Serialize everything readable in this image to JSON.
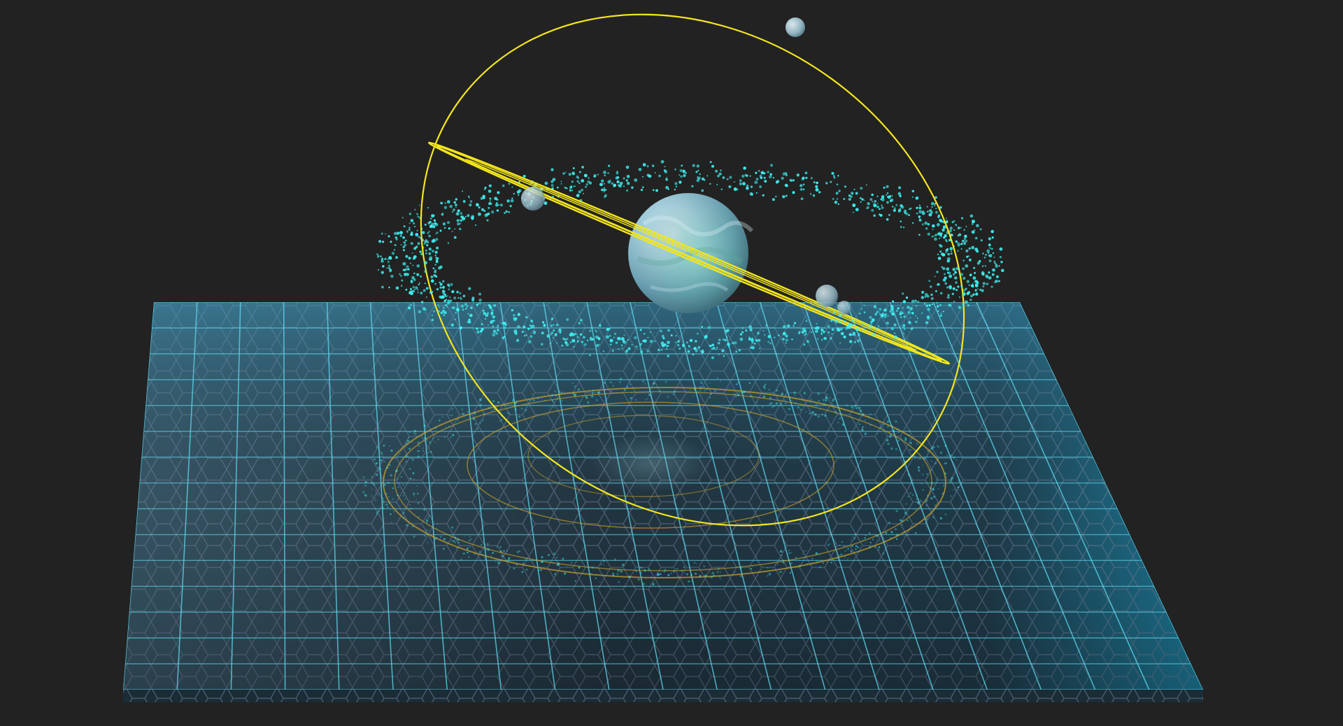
{
  "scene": {
    "background": "#222222",
    "grid_line_color": "#5fd8ee",
    "hex_pattern_color": "#7d8aa6",
    "orbit_color": "#f4e61c",
    "reflection_orbit_color": "#c9a12a",
    "particle_color": "#3ff2f2",
    "planet_color": "#a9d6e8",
    "moon_color": "#b6d2dc",
    "objects": {
      "planet": "central-planet",
      "moons": [
        "moon-top",
        "moon-left",
        "moon-right"
      ],
      "orbits": [
        "large-tilted-orbit",
        "inclined-ring-orbit"
      ],
      "particle_belt": "asteroid-belt",
      "platform": "hex-grid-platform"
    }
  }
}
